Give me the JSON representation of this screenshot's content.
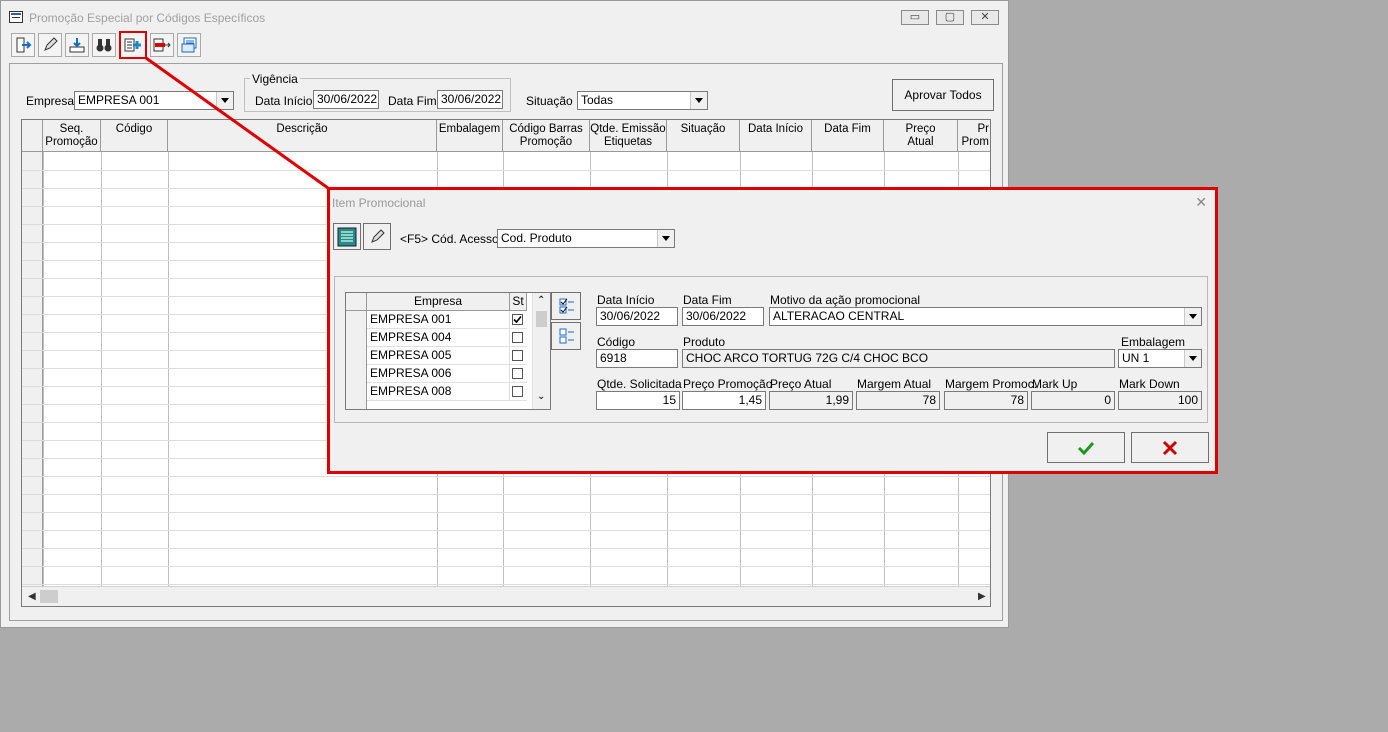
{
  "main_window": {
    "title": "Promoção Especial por Códigos Específicos",
    "controls": {
      "minimize": "▭",
      "maximize": "▢",
      "close": "✕"
    }
  },
  "toolbar": {
    "buttons": [
      "exit-icon",
      "edit-pencil-icon",
      "import-icon",
      "binoculars-icon",
      "add-item-icon",
      "remove-item-icon",
      "print-icon"
    ],
    "highlighted": "add-item-icon"
  },
  "filters": {
    "empresa_label": "Empresa",
    "empresa_value": "EMPRESA 001",
    "vigencia_label": "Vigência",
    "data_inicio_label": "Data Início",
    "data_inicio_value": "30/06/2022",
    "data_fim_label": "Data Fim",
    "data_fim_value": "30/06/2022",
    "situacao_label": "Situação",
    "situacao_value": "Todas",
    "aprovar_label": "Aprovar Todos"
  },
  "grid": {
    "columns": [
      {
        "l1": "Seq.",
        "l2": "Promoção"
      },
      {
        "l1": "Código",
        "l2": ""
      },
      {
        "l1": "Descrição",
        "l2": ""
      },
      {
        "l1": "Embalagem",
        "l2": ""
      },
      {
        "l1": "Código Barras",
        "l2": "Promoção"
      },
      {
        "l1": "Qtde. Emissão",
        "l2": "Etiquetas"
      },
      {
        "l1": "Situação",
        "l2": ""
      },
      {
        "l1": "Data Início",
        "l2": ""
      },
      {
        "l1": "Data Fim",
        "l2": ""
      },
      {
        "l1": "Preço",
        "l2": "Atual"
      },
      {
        "l1": "Pr",
        "l2": "Prom"
      }
    ]
  },
  "dialog": {
    "title": "Item Promocional",
    "close": "✕",
    "acesso_label": "<F5> Cód. Acesso",
    "acesso_value": "Cod. Produto",
    "empresa_header": "Empresa",
    "st_header": "St",
    "empresas": [
      {
        "name": "EMPRESA 001",
        "checked": true
      },
      {
        "name": "EMPRESA 004",
        "checked": false
      },
      {
        "name": "EMPRESA 005",
        "checked": false
      },
      {
        "name": "EMPRESA 006",
        "checked": false
      },
      {
        "name": "EMPRESA 008",
        "checked": false
      }
    ],
    "data_inicio_label": "Data Início",
    "data_inicio_value": "30/06/2022",
    "data_fim_label": "Data Fim",
    "data_fim_value": "30/06/2022",
    "motivo_label": "Motivo da ação promocional",
    "motivo_value": "ALTERACAO CENTRAL",
    "codigo_label": "Código",
    "codigo_value": "6918",
    "produto_label": "Produto",
    "produto_value": "CHOC ARCO TORTUG 72G C/4 CHOC BCO",
    "embalagem_label": "Embalagem",
    "embalagem_value": "UN 1",
    "qtde_label": "Qtde. Solicitada",
    "qtde_value": "15",
    "preco_promo_label": "Preço Promoção",
    "preco_promo_value": "1,45",
    "preco_atual_label": "Preço Atual",
    "preco_atual_value": "1,99",
    "margem_atual_label": "Margem Atual",
    "margem_atual_value": "78",
    "margem_promo_label": "Margem Promoc.",
    "margem_promo_value": "78",
    "markup_label": "Mark Up",
    "markup_value": "0",
    "markdown_label": "Mark Down",
    "markdown_value": "100",
    "ok_icon": "check-icon",
    "cancel_icon": "x-icon"
  },
  "colors": {
    "highlight": "#e00000",
    "ok": "#1a9a1a",
    "cancel": "#d00000"
  }
}
